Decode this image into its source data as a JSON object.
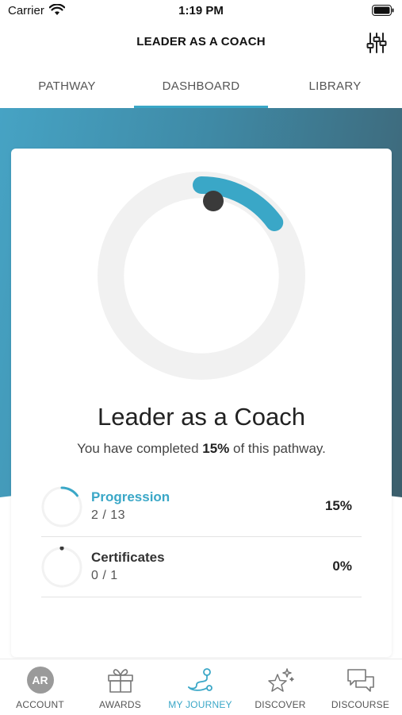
{
  "status_bar": {
    "carrier": "Carrier",
    "time": "1:19 PM"
  },
  "header": {
    "title": "LEADER AS A COACH"
  },
  "tabs": [
    {
      "label": "PATHWAY"
    },
    {
      "label": "DASHBOARD",
      "active": true
    },
    {
      "label": "LIBRARY"
    }
  ],
  "pathway": {
    "title": "Leader as a Coach",
    "subtitle_prefix": "You have completed ",
    "subtitle_value": "15%",
    "subtitle_suffix": " of this pathway.",
    "progress_fraction": 0.15
  },
  "stats": [
    {
      "label": "Progression",
      "count": "2 / 13",
      "percent": "15%",
      "fraction": 0.15,
      "label_color": "#3aa7c7"
    },
    {
      "label": "Certificates",
      "count": "0 / 1",
      "percent": "0%",
      "fraction": 0.0,
      "label_color": "#333333"
    }
  ],
  "tabbar": [
    {
      "label": "ACCOUNT",
      "icon": "avatar",
      "avatar_initials": "AR"
    },
    {
      "label": "AWARDS",
      "icon": "gift-icon"
    },
    {
      "label": "MY JOURNEY",
      "icon": "route-icon",
      "active": true
    },
    {
      "label": "DISCOVER",
      "icon": "sparkle-star-icon"
    },
    {
      "label": "DISCOURSE",
      "icon": "chat-bubbles-icon"
    }
  ],
  "colors": {
    "accent": "#3aa7c7",
    "gradient_start": "#46a3c4",
    "gradient_end": "#3b5d6a"
  }
}
